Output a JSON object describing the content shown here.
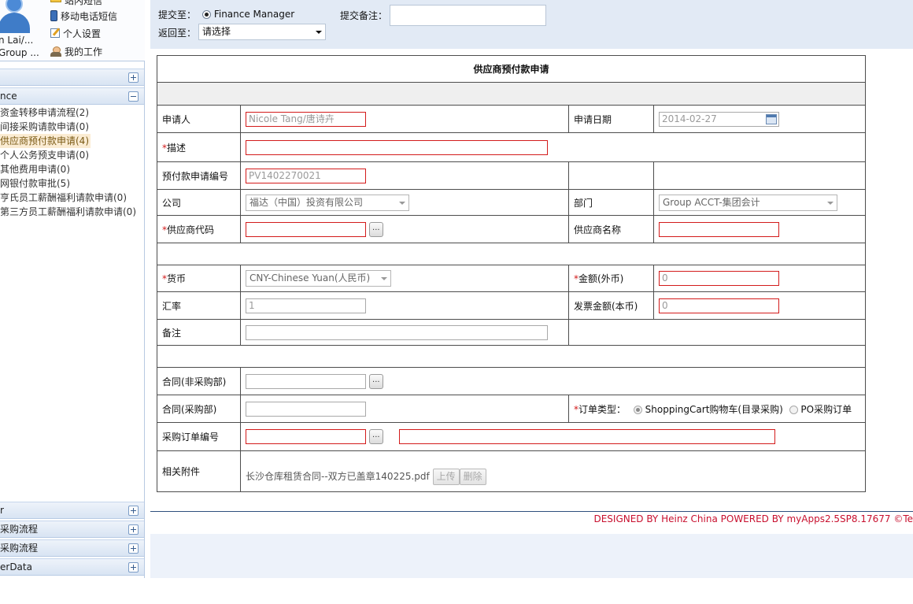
{
  "sidebar": {
    "user": {
      "name": "n Lai/...",
      "group": "Group ..."
    },
    "quick_links": [
      {
        "label": "站内短信",
        "icon": "envelope-icon"
      },
      {
        "label": "移动电话短信",
        "icon": "mobile-phone-icon"
      },
      {
        "label": "个人设置",
        "icon": "edit-settings-icon"
      },
      {
        "label": "我的工作",
        "icon": "user-work-icon"
      }
    ],
    "top_section": {
      "label": ""
    },
    "finance_section": {
      "label": "nce"
    },
    "workflows": [
      {
        "label": "资金转移申请流程(2)"
      },
      {
        "label": "间接采购请款申请(0)"
      },
      {
        "label": "供应商预付款申请(4)"
      },
      {
        "label": "个人公务预支申请(0)"
      },
      {
        "label": "其他费用申请(0)"
      },
      {
        "label": "网银付款审批(5)"
      },
      {
        "label": "亨氏员工薪酬福利请款申请(0)"
      },
      {
        "label": "第三方员工薪酬福利请款申请(0)"
      }
    ],
    "bottom_sections": [
      {
        "label": "r"
      },
      {
        "label": "采购流程"
      },
      {
        "label": "采购流程"
      },
      {
        "label": "erData"
      }
    ]
  },
  "topbar": {
    "submit_to_label": "提交至：",
    "submit_to_value": "Finance Manager",
    "submit_note_label": "提交备注：",
    "submit_note_value": "",
    "return_to_label": "返回至：",
    "return_to_value": "请选择"
  },
  "form": {
    "title": "供应商预付款申请",
    "applicant_label": "申请人",
    "applicant_value": "Nicole Tang/唐诗卉",
    "apply_date_label": "申请日期",
    "apply_date_value": "2014-02-27",
    "description_label": "描述",
    "description_value": "",
    "prepay_no_label": "预付款申请编号",
    "prepay_no_value": "PV1402270021",
    "company_label": "公司",
    "company_value": "福达（中国）投资有限公司",
    "department_label": "部门",
    "department_value": "Group ACCT-集团会计",
    "vendor_code_label": "供应商代码",
    "vendor_code_value": "",
    "vendor_name_label": "供应商名称",
    "vendor_name_value": "",
    "currency_label": "货币",
    "currency_value": "CNY-Chinese Yuan(人民币)",
    "amount_label": "金额(外币)",
    "amount_value": "0",
    "rate_label": "汇率",
    "rate_value": "1",
    "invoice_amount_label": "发票金额(本币)",
    "invoice_amount_value": "0",
    "remark_label": "备注",
    "remark_value": "",
    "contract_nonpurch_label": "合同(非采购部)",
    "contract_nonpurch_value": "",
    "contract_purch_label": "合同(采购部)",
    "contract_purch_value": "",
    "order_type_label": "订单类型：",
    "order_type_options": [
      "ShoppingCart购物车(目录采购)",
      "PO采购订单"
    ],
    "po_no_label": "采购订单编号",
    "po_no_value": "",
    "po_desc_value": "",
    "attachment_label": "相关附件",
    "attachment_file": "长沙仓库租赁合同--双方已盖章140225.pdf",
    "upload_label": "上传",
    "delete_label": "删除",
    "browse_label": "..."
  },
  "footer": {
    "text": "DESIGNED BY Heinz China POWERED BY myApps2.5SP8.17677 ©Te"
  }
}
